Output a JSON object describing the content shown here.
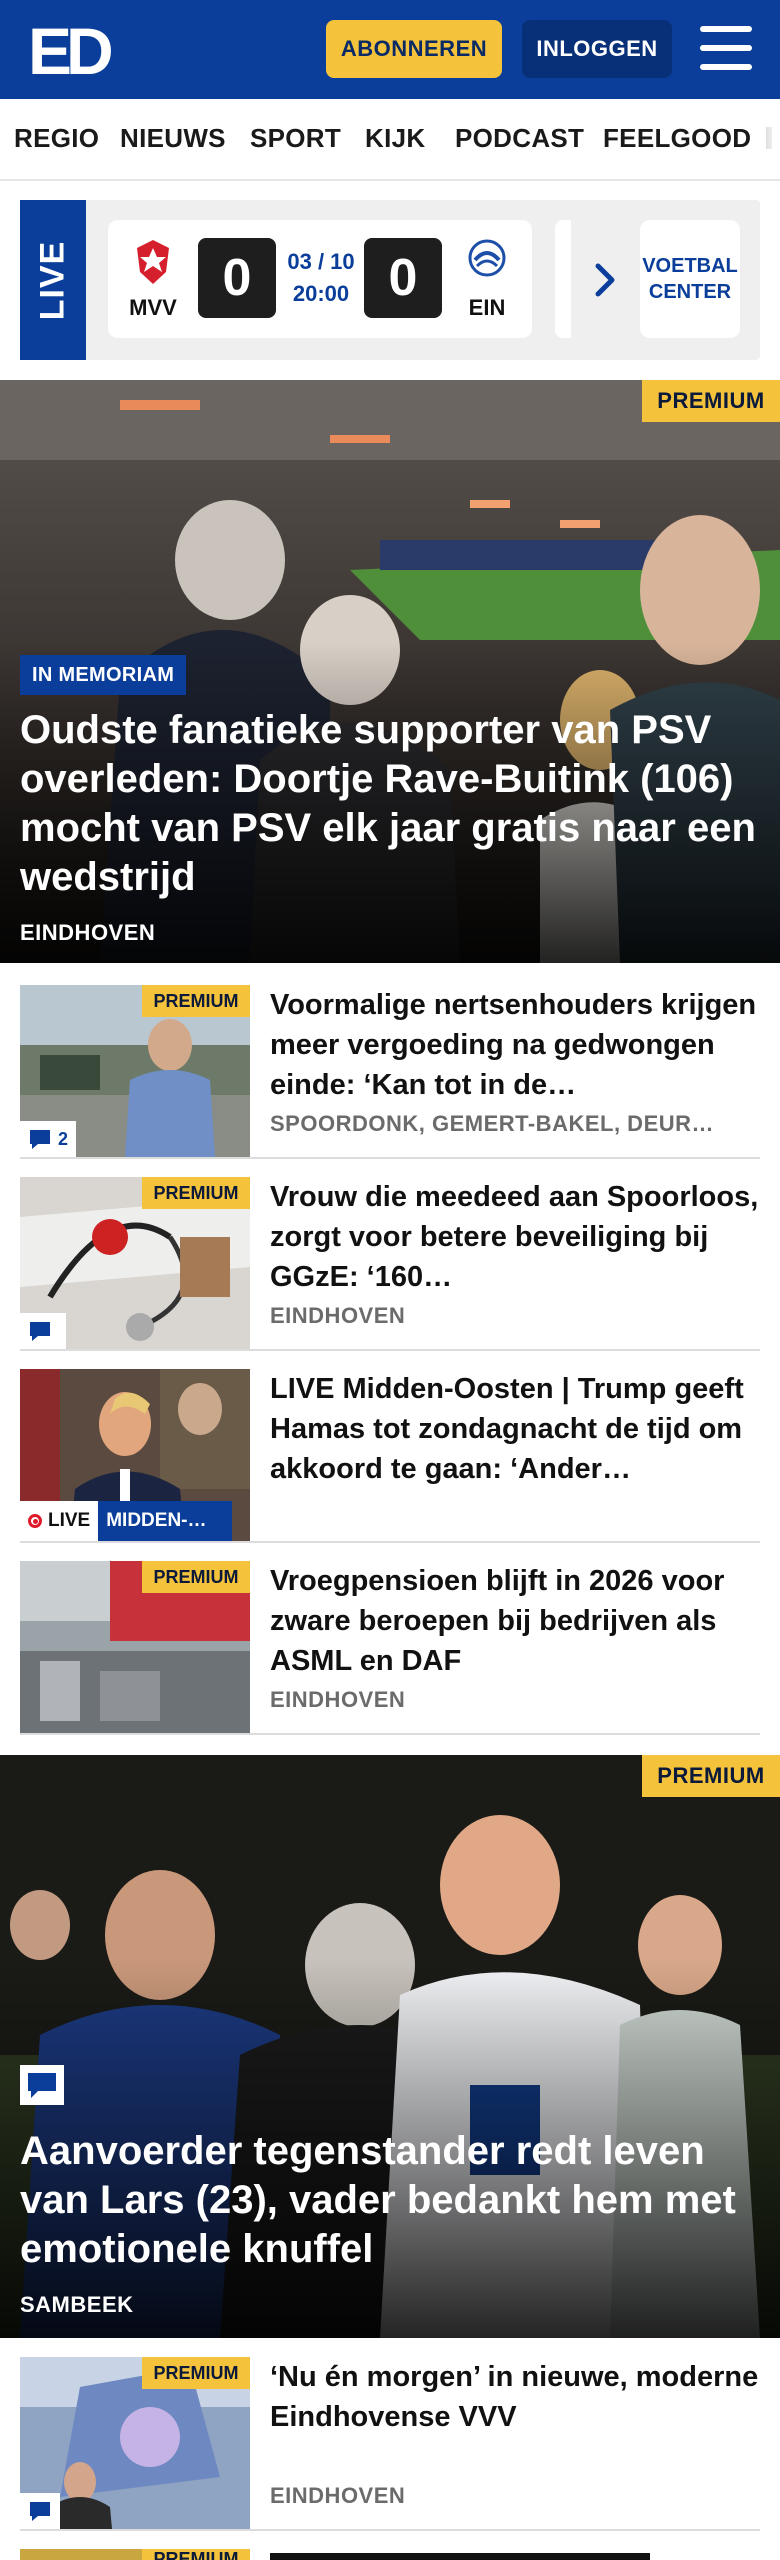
{
  "header": {
    "logo_text": "ED",
    "subscribe_label": "ABONNEREN",
    "login_label": "INLOGGEN",
    "menu_icon": "hamburger-menu-icon"
  },
  "nav": {
    "items": [
      "REGIO",
      "NIEUWS",
      "SPORT",
      "KIJK",
      "PODCAST",
      "FEELGOOD"
    ]
  },
  "live": {
    "tab_label": "LIVE",
    "match": {
      "home": "MVV",
      "home_score": "0",
      "date": "03 / 10",
      "time": "20:00",
      "away_score": "0",
      "away": "EIN"
    },
    "voetbal_center": "VOETBAL CENTER"
  },
  "hero1": {
    "badge": "PREMIUM",
    "tag": "IN MEMORIAM",
    "title": "Oudste fanatieke supporter van PSV overleden: Doortje Rave-Buitink (106) mocht van PSV elk jaar gratis naar een wedstrijd",
    "place": "EINDHOVEN"
  },
  "articles": [
    {
      "badge": "PREMIUM",
      "comments": "2",
      "title": "Voormalige nertsenhouders krijgen meer vergoeding na gedwongen einde: ‘Kan tot in de…",
      "place": "SPOORDONK, GEMERT-BAKEL, DEUR…"
    },
    {
      "badge": "PREMIUM",
      "comments": "",
      "title": "Vrouw die meedeed aan Spoorloos, zorgt voor betere beveiliging bij GGzE: ‘160…",
      "place": "EINDHOVEN"
    },
    {
      "live": "LIVE",
      "live_topic": "MIDDEN-…",
      "title": "LIVE Midden-Oosten | Trump geeft Hamas tot zondagnacht de tijd om akkoord te gaan: ‘Ander…"
    },
    {
      "badge": "PREMIUM",
      "title": "Vroegpensioen blijft in 2026 voor zware beroepen bij bedrijven als ASML en DAF",
      "place": "EINDHOVEN"
    }
  ],
  "hero2": {
    "badge": "PREMIUM",
    "title": "Aanvoerder tegenstander redt leven van Lars (23), vader bedankt hem met emotionele knuffel",
    "place": "SAMBEEK"
  },
  "article5": {
    "badge": "PREMIUM",
    "title": "‘Nu én morgen’ in nieuwe, moderne Eindhovense VVV",
    "place": "EINDHOVEN"
  },
  "article6": {
    "badge": "PREMIUM"
  }
}
